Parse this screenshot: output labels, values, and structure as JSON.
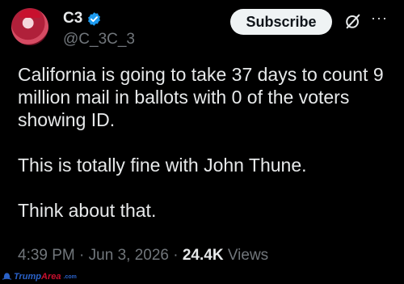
{
  "author": {
    "display_name": "C3",
    "handle": "@C_3C_3",
    "verified_icon": "verified-badge-icon",
    "avatar": "avatar-image"
  },
  "actions": {
    "subscribe_label": "Subscribe",
    "grok_icon": "grok-icon",
    "more_icon": "more-options-icon",
    "more_glyph": "···"
  },
  "post": {
    "paragraphs": [
      "California is going to take 37 days to count 9 million mail in ballots with 0 of the voters showing ID.",
      "This is totally fine with John Thune.",
      "Think about that."
    ]
  },
  "meta": {
    "time": "4:39 PM",
    "separator": "·",
    "date": "Jun 3, 2026",
    "views_count": "24.4K",
    "views_label": "Views"
  },
  "watermark": {
    "part1": "Trump",
    "part2": "Area",
    "tld": ".com"
  },
  "colors": {
    "background": "#000000",
    "text": "#e7e9ea",
    "muted": "#71767b",
    "verified": "#1d9bf0",
    "button_bg": "#eff3f4"
  }
}
